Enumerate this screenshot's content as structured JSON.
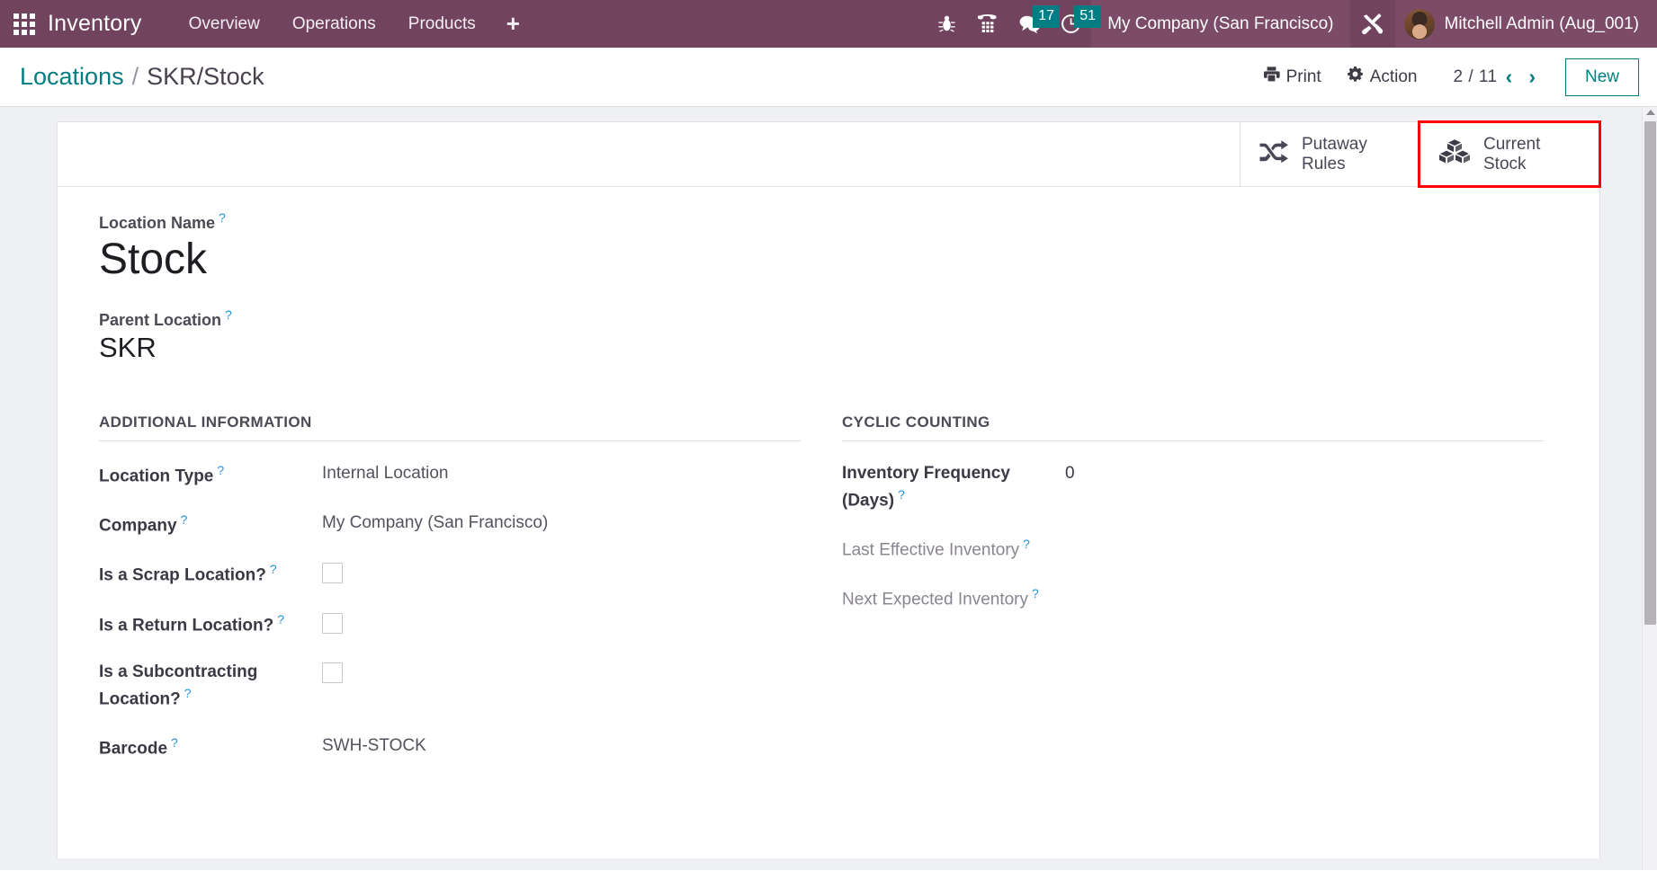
{
  "navbar": {
    "apps_icon": "grid-apps-icon",
    "brand": "Inventory",
    "menu": [
      {
        "label": "Overview",
        "name": "nav-overview"
      },
      {
        "label": "Operations",
        "name": "nav-operations"
      },
      {
        "label": "Products",
        "name": "nav-products"
      },
      {
        "label": "+",
        "name": "nav-add"
      }
    ],
    "sys_icons": [
      {
        "name": "bug-icon",
        "badge": null
      },
      {
        "name": "dialpad-icon",
        "badge": null
      },
      {
        "name": "messages-icon",
        "badge": "17"
      },
      {
        "name": "activities-clock-icon",
        "badge": "51"
      }
    ],
    "company": "My Company (San Francisco)",
    "tools_icon": "tools-icon",
    "user": "Mitchell Admin (Aug_001)"
  },
  "control_panel": {
    "breadcrumb_root": "Locations",
    "breadcrumb_sep": "/",
    "breadcrumb_current": "SKR/Stock",
    "print_label": "Print",
    "action_label": "Action",
    "pager": "2 / 11",
    "prev_arrow": "‹",
    "next_arrow": "›",
    "new_label": "New"
  },
  "stat_buttons": [
    {
      "name": "stat-putaway-rules",
      "icon": "shuffle-icon",
      "line1": "Putaway",
      "line2": "Rules",
      "highlighted": false
    },
    {
      "name": "stat-current-stock",
      "icon": "cubes-icon",
      "line1": "Current",
      "line2": "Stock",
      "highlighted": true
    }
  ],
  "form": {
    "location_name_label": "Location Name",
    "location_name_value": "Stock",
    "parent_location_label": "Parent Location",
    "parent_location_value": "SKR",
    "left_group": {
      "title": "ADDITIONAL INFORMATION",
      "rows": [
        {
          "label": "Location Type",
          "value": "Internal Location",
          "type": "text"
        },
        {
          "label": "Company",
          "value": "My Company (San Francisco)",
          "type": "text"
        },
        {
          "label": "Is a Scrap Location?",
          "value": "",
          "type": "checkbox",
          "checked": false
        },
        {
          "label": "Is a Return Location?",
          "value": "",
          "type": "checkbox",
          "checked": false
        },
        {
          "label": "Is a Subcontracting Location?",
          "value": "",
          "type": "checkbox",
          "checked": false
        },
        {
          "label": "Barcode",
          "value": "SWH-STOCK",
          "type": "text"
        }
      ]
    },
    "right_group": {
      "title": "CYCLIC COUNTING",
      "rows": [
        {
          "label": "Inventory Frequency (Days)",
          "value": "0",
          "type": "text",
          "muted": false
        },
        {
          "label": "Last Effective Inventory",
          "value": "",
          "type": "text",
          "muted": true
        },
        {
          "label": "Next Expected Inventory",
          "value": "",
          "type": "text",
          "muted": true
        }
      ]
    }
  },
  "colors": {
    "navbar_bg": "#71435f",
    "accent_teal": "#017e84",
    "badge_teal": "#017e84",
    "highlight_red": "#ff0000",
    "body_bg": "#eef0f3"
  }
}
